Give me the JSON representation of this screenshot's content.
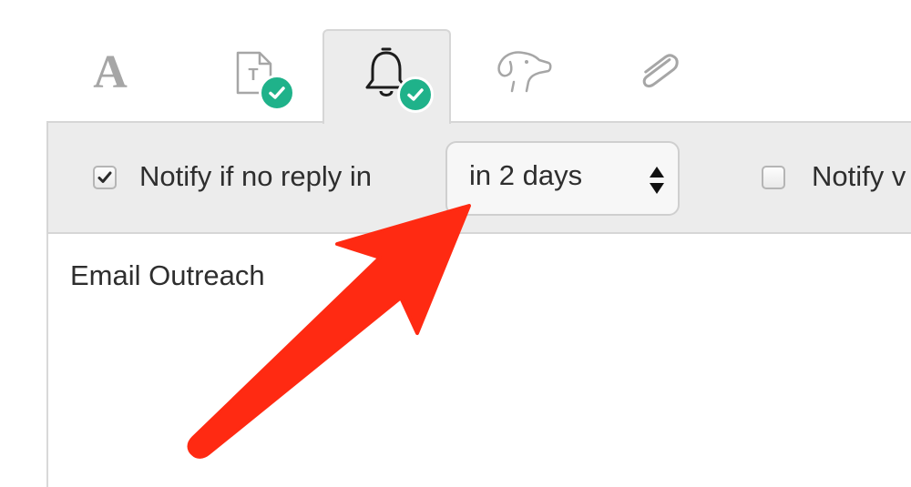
{
  "tabs": [
    {
      "id": "font",
      "icon": "font-icon",
      "active": false,
      "has_check": false
    },
    {
      "id": "template",
      "icon": "text-template-icon",
      "active": false,
      "has_check": true
    },
    {
      "id": "reminder",
      "icon": "bell-icon",
      "active": true,
      "has_check": true
    },
    {
      "id": "sniffer",
      "icon": "dog-icon",
      "active": false,
      "has_check": false
    },
    {
      "id": "attachment",
      "icon": "paperclip-icon",
      "active": false,
      "has_check": false
    }
  ],
  "toolbar": {
    "notify_no_reply": {
      "label": "Notify if no reply in",
      "checked": true
    },
    "reply_timing": {
      "value": "in 2 days"
    },
    "notify_second": {
      "label": "Notify v",
      "checked": false
    }
  },
  "content": {
    "title": "Email Outreach"
  },
  "colors": {
    "accent_green": "#1fb28a",
    "annotation_red": "#ff2a12",
    "toolbar_bg": "#ececec"
  }
}
